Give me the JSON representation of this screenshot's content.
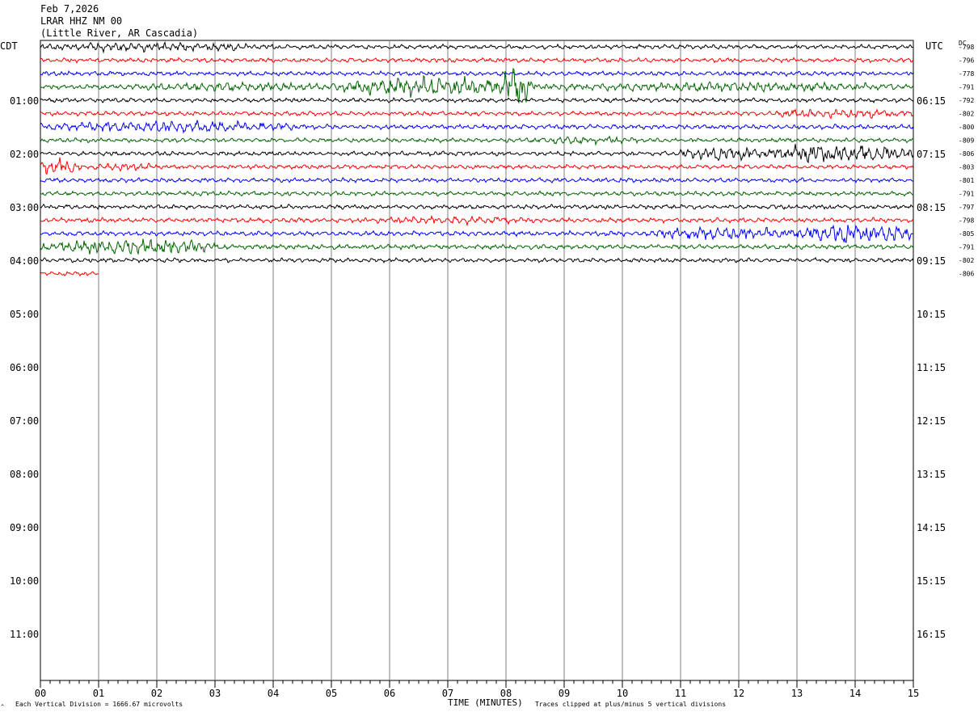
{
  "header": {
    "date": "Feb 7,2026",
    "station": "LRAR HHZ NM 00",
    "location": "(Little River, AR Cascadia)"
  },
  "left_label": "CDT",
  "right_label": "UTC",
  "dc_label": "DC",
  "footer": {
    "scale_note": "Each Vertical Division = 1666.67 microvolts",
    "time_label": "TIME (MINUTES)",
    "clip_note": "Traces clipped at plus/minus 5 vertical divisions"
  },
  "corner_mark": "^",
  "chart_data": {
    "type": "line",
    "title": "LRAR HHZ NM 00",
    "xlabel": "TIME (MINUTES)",
    "x_ticks": [
      "00",
      "01",
      "02",
      "03",
      "04",
      "05",
      "06",
      "07",
      "08",
      "09",
      "10",
      "11",
      "12",
      "13",
      "14",
      "15"
    ],
    "xlim": [
      0,
      15
    ],
    "grid": true,
    "left_time_labels": [
      "01:00",
      "02:00",
      "03:00",
      "04:00",
      "05:00",
      "06:00",
      "07:00",
      "08:00",
      "09:00",
      "10:00",
      "11:00"
    ],
    "right_time_labels": [
      "06:15",
      "07:15",
      "08:15",
      "09:15",
      "10:15",
      "11:15",
      "12:15",
      "13:15",
      "14:15",
      "15:15",
      "16:15"
    ],
    "trace_colors": [
      "#000000",
      "#ff0000",
      "#0000ff",
      "#006400"
    ],
    "traces": [
      {
        "row": 0,
        "dc": "-798",
        "end_min": 15,
        "amp": 2.2,
        "events": [
          {
            "t0": 0,
            "t1": 4,
            "a": 5
          }
        ]
      },
      {
        "row": 1,
        "dc": "-796",
        "end_min": 15,
        "amp": 2.2,
        "events": []
      },
      {
        "row": 2,
        "dc": "-778",
        "end_min": 15,
        "amp": 2.2,
        "events": []
      },
      {
        "row": 3,
        "dc": "-791",
        "end_min": 15,
        "amp": 2.4,
        "events": [
          {
            "t0": 1.5,
            "t1": 5,
            "a": 5
          },
          {
            "t0": 5,
            "t1": 8.5,
            "a": 10
          },
          {
            "t0": 7.9,
            "t1": 8.4,
            "a": 22
          },
          {
            "t0": 8.5,
            "t1": 15,
            "a": 5
          }
        ]
      },
      {
        "row": 4,
        "dc": "-792",
        "end_min": 15,
        "amp": 2.2,
        "events": []
      },
      {
        "row": 5,
        "dc": "-802",
        "end_min": 15,
        "amp": 2.2,
        "events": [
          {
            "t0": 12.5,
            "t1": 15,
            "a": 5
          }
        ]
      },
      {
        "row": 6,
        "dc": "-800",
        "end_min": 15,
        "amp": 2.4,
        "events": [
          {
            "t0": 0,
            "t1": 4.5,
            "a": 6
          }
        ]
      },
      {
        "row": 7,
        "dc": "-809",
        "end_min": 15,
        "amp": 2.2,
        "events": [
          {
            "t0": 8,
            "t1": 10.5,
            "a": 4
          }
        ]
      },
      {
        "row": 8,
        "dc": "-806",
        "end_min": 15,
        "amp": 2.2,
        "events": [
          {
            "t0": 11,
            "t1": 12.5,
            "a": 7
          },
          {
            "t0": 12.5,
            "t1": 15,
            "a": 10
          }
        ]
      },
      {
        "row": 9,
        "dc": "-803",
        "end_min": 15,
        "amp": 2.2,
        "events": [
          {
            "t0": 0,
            "t1": 0.7,
            "a": 9
          },
          {
            "t0": 0.7,
            "t1": 2.2,
            "a": 4
          }
        ]
      },
      {
        "row": 10,
        "dc": "-801",
        "end_min": 15,
        "amp": 2.2,
        "events": []
      },
      {
        "row": 11,
        "dc": "-791",
        "end_min": 15,
        "amp": 2.2,
        "events": []
      },
      {
        "row": 12,
        "dc": "-797",
        "end_min": 15,
        "amp": 2.2,
        "events": []
      },
      {
        "row": 13,
        "dc": "-798",
        "end_min": 15,
        "amp": 2.4,
        "events": [
          {
            "t0": 5.5,
            "t1": 8.8,
            "a": 4.5
          }
        ]
      },
      {
        "row": 14,
        "dc": "-805",
        "end_min": 15,
        "amp": 2.4,
        "events": [
          {
            "t0": 10.5,
            "t1": 13,
            "a": 7
          },
          {
            "t0": 13,
            "t1": 15,
            "a": 11
          }
        ]
      },
      {
        "row": 15,
        "dc": "-791",
        "end_min": 15,
        "amp": 2.4,
        "events": [
          {
            "t0": 0,
            "t1": 3,
            "a": 8
          }
        ]
      },
      {
        "row": 16,
        "dc": "-802",
        "end_min": 15,
        "amp": 2.2,
        "events": []
      },
      {
        "row": 17,
        "dc": "-806",
        "end_min": 1,
        "amp": 2.2,
        "events": []
      }
    ]
  }
}
